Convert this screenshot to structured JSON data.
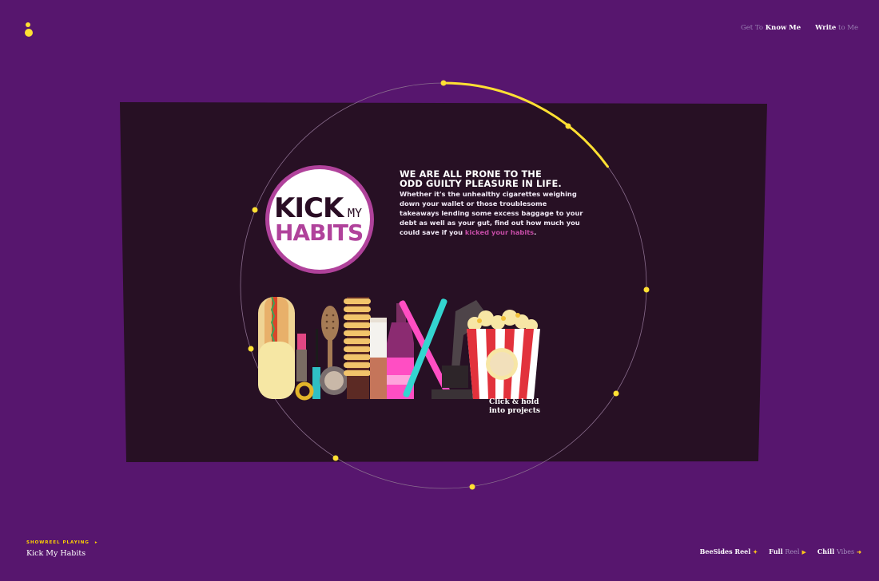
{
  "nav": {
    "item1_prefix": "Get To",
    "item1_bold": "Know Me",
    "item2_bold": "Write",
    "item2_suffix": "to Me"
  },
  "project": {
    "logo_line1": "KICK",
    "logo_my": "MY",
    "logo_line2": "HABITS",
    "headline_line1": "WE ARE ALL PRONE TO THE",
    "headline_line2": "ODD GUILTY PLEASURE IN LIFE.",
    "body_l1": "Whether it's the unhealthy cigarettes weighing",
    "body_l2": "down your wallet or those troublesome",
    "body_l3": "takeaways lending some excess baggage to your",
    "body_l4": "debt as well as your gut, find out how much you",
    "body_l5_pre": "could save if you",
    "body_l5_link": "kicked your habits",
    "body_l5_post": ".",
    "hint_l1": "Click & hold",
    "hint_l2": "into projects",
    "progress": 0.15
  },
  "footer": {
    "playing_label": "SHOWREEL PLAYING",
    "playing_arrow": "▸",
    "playing_title": "Kick My Habits",
    "reel1_bold": "BeeSides",
    "reel1_mid": "Reel",
    "reel2_bold": "Full",
    "reel2_mid": "Reel",
    "reel3_bold": "Chill",
    "reel3_mid": "Vibes"
  },
  "colors": {
    "background": "#57166e",
    "panel": "#271024",
    "accent_yellow": "#ffe033",
    "brand_pink": "#b0429b"
  }
}
